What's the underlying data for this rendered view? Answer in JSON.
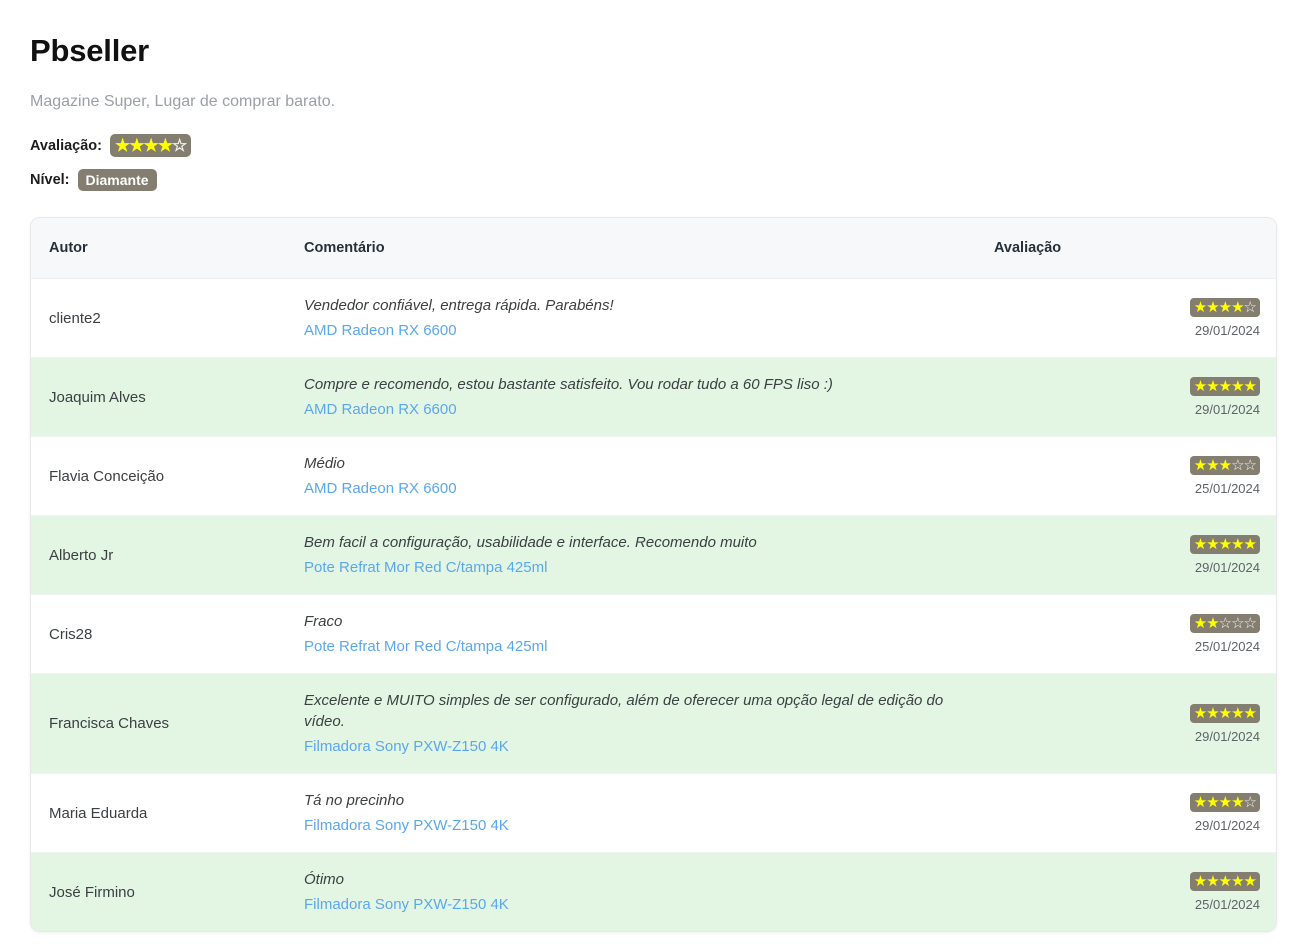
{
  "seller": {
    "name": "Pbseller",
    "tagline": "Magazine Super, Lugar de comprar barato.",
    "rating_label": "Avaliação:",
    "rating_stars": 4,
    "rating_max": 5,
    "level_label": "Nível:",
    "level_value": "Diamante"
  },
  "table": {
    "columns": [
      "Autor",
      "Comentário",
      "Avaliação"
    ],
    "rows": [
      {
        "author": "cliente2",
        "comment": "Vendedor confiável, entrega rápida. Parabéns!",
        "product": "AMD Radeon RX 6600",
        "stars": 4,
        "date": "29/01/2024"
      },
      {
        "author": "Joaquim Alves",
        "comment": "Compre e recomendo, estou bastante satisfeito. Vou rodar tudo a 60 FPS liso :)",
        "product": "AMD Radeon RX 6600",
        "stars": 5,
        "date": "29/01/2024"
      },
      {
        "author": "Flavia Conceição",
        "comment": "Médio",
        "product": "AMD Radeon RX 6600",
        "stars": 3,
        "date": "25/01/2024"
      },
      {
        "author": "Alberto Jr",
        "comment": "Bem facil a configuração, usabilidade e interface. Recomendo muito",
        "product": "Pote Refrat Mor Red C/tampa 425ml",
        "stars": 5,
        "date": "29/01/2024"
      },
      {
        "author": "Cris28",
        "comment": "Fraco",
        "product": "Pote Refrat Mor Red C/tampa 425ml",
        "stars": 2,
        "date": "25/01/2024"
      },
      {
        "author": "Francisca Chaves",
        "comment": "Excelente e MUITO simples de ser configurado, além de oferecer uma opção legal de edição do vídeo.",
        "product": "Filmadora Sony PXW-Z150 4K",
        "stars": 5,
        "date": "29/01/2024"
      },
      {
        "author": "Maria Eduarda",
        "comment": "Tá no precinho",
        "product": "Filmadora Sony PXW-Z150 4K",
        "stars": 4,
        "date": "29/01/2024"
      },
      {
        "author": "José Firmino",
        "comment": "Ótimo",
        "product": "Filmadora Sony PXW-Z150 4K",
        "stars": 5,
        "date": "25/01/2024"
      }
    ],
    "star_max": 5,
    "star_filled_glyph": "★",
    "star_empty_glyph": "☆"
  },
  "colors": {
    "badge_bg": "#847e70",
    "star_filled": "#ffff00",
    "star_empty": "#f2f2ef",
    "row_even_bg": "#e3f6e3",
    "link": "#5ba7ef"
  }
}
